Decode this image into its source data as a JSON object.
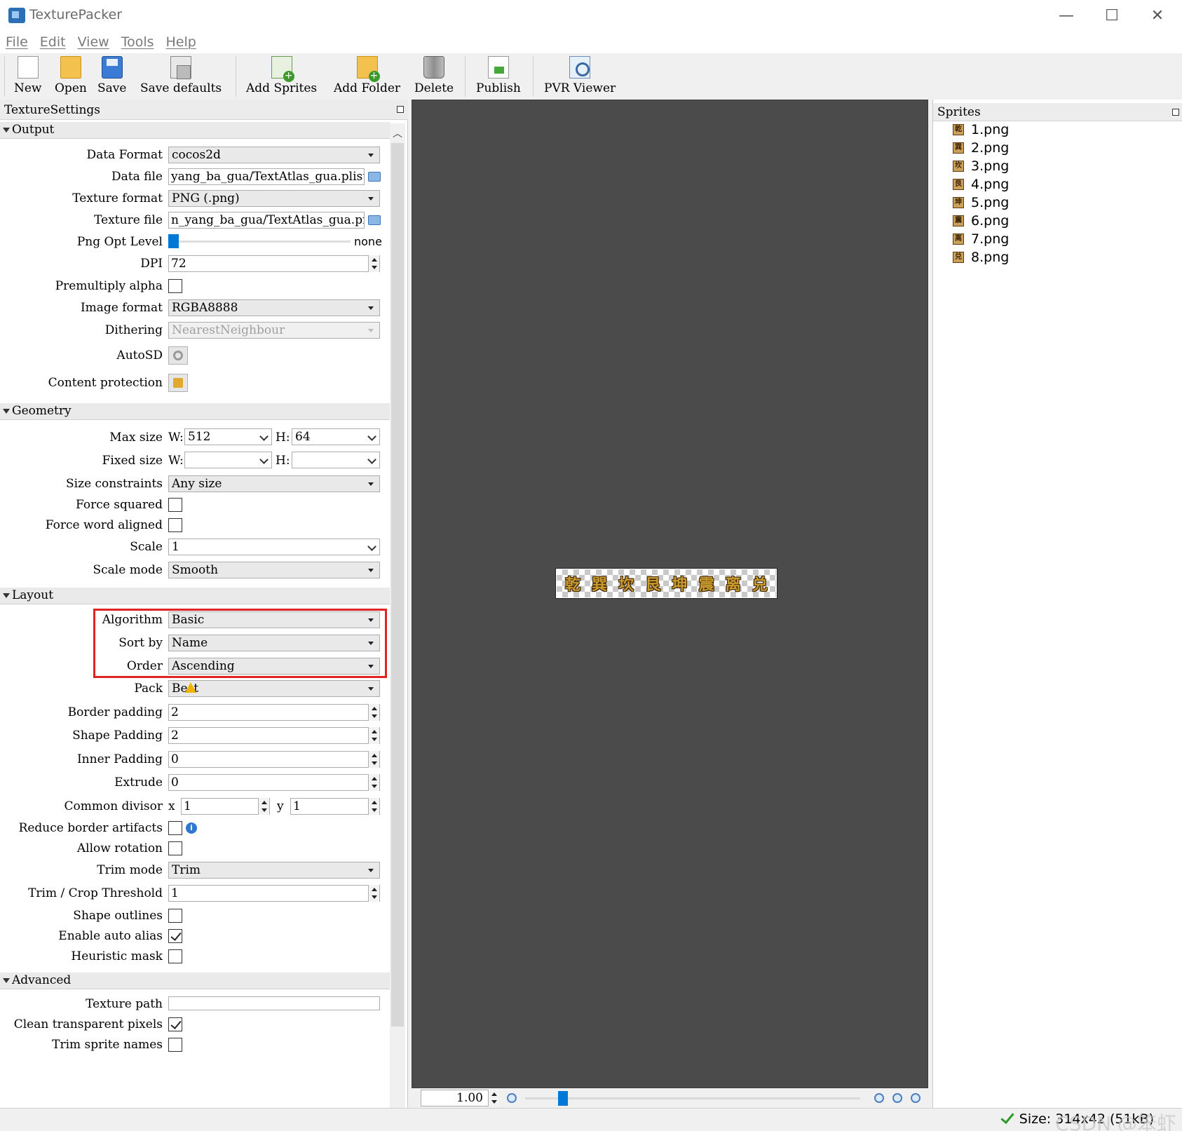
{
  "window": {
    "title": "TexturePacker",
    "minimize": "—",
    "maximize": "☐",
    "close": "✕"
  },
  "menu": [
    "File",
    "Edit",
    "View",
    "Tools",
    "Help"
  ],
  "toolbar": {
    "new": "New",
    "open": "Open",
    "save": "Save",
    "save_defaults": "Save defaults",
    "add_sprites": "Add Sprites",
    "add_folder": "Add Folder",
    "delete": "Delete",
    "publish": "Publish",
    "pvr_viewer": "PVR Viewer"
  },
  "settings": {
    "panel_title": "TextureSettings",
    "output": {
      "section": "Output",
      "data_format_label": "Data Format",
      "data_format": "cocos2d",
      "data_file_label": "Data file",
      "data_file": "yang_ba_gua/TextAtlas_gua.plist",
      "texture_format_label": "Texture format",
      "texture_format": "PNG (.png)",
      "texture_file_label": "Texture file",
      "texture_file": "n_yang_ba_gua/TextAtlas_gua.png",
      "png_opt_label": "Png Opt Level",
      "png_opt_value": "none",
      "png_opt_level": 0,
      "dpi_label": "DPI",
      "dpi": "72",
      "premultiply_label": "Premultiply alpha",
      "premultiply": false,
      "image_format_label": "Image format",
      "image_format": "RGBA8888",
      "dithering_label": "Dithering",
      "dithering": "NearestNeighbour",
      "autosd_label": "AutoSD",
      "content_protection_label": "Content protection"
    },
    "geometry": {
      "section": "Geometry",
      "max_size_label": "Max size",
      "w_label": "W:",
      "h_label": "H:",
      "max_w": "512",
      "max_h": "64",
      "fixed_size_label": "Fixed size",
      "fixed_w": "",
      "fixed_h": "",
      "size_constraints_label": "Size constraints",
      "size_constraints": "Any size",
      "force_squared_label": "Force squared",
      "force_squared": false,
      "force_word_label": "Force word aligned",
      "force_word": false,
      "scale_label": "Scale",
      "scale": "1",
      "scale_mode_label": "Scale mode",
      "scale_mode": "Smooth"
    },
    "layout": {
      "section": "Layout",
      "algorithm_label": "Algorithm",
      "algorithm": "Basic",
      "sort_by_label": "Sort by",
      "sort_by": "Name",
      "order_label": "Order",
      "order": "Ascending",
      "pack_label": "Pack",
      "pack": "Best",
      "border_padding_label": "Border padding",
      "border_padding": "2",
      "shape_padding_label": "Shape Padding",
      "shape_padding": "2",
      "inner_padding_label": "Inner Padding",
      "inner_padding": "0",
      "extrude_label": "Extrude",
      "extrude": "0",
      "common_divisor_label": "Common divisor",
      "x_label": "x",
      "y_label": "y",
      "divisor_x": "1",
      "divisor_y": "1",
      "reduce_border_label": "Reduce border artifacts",
      "reduce_border": false,
      "allow_rotation_label": "Allow rotation",
      "allow_rotation": false,
      "trim_mode_label": "Trim mode",
      "trim_mode": "Trim",
      "trim_threshold_label": "Trim / Crop Threshold",
      "trim_threshold": "1",
      "shape_outlines_label": "Shape outlines",
      "shape_outlines": false,
      "auto_alias_label": "Enable auto alias",
      "auto_alias": true,
      "heuristic_mask_label": "Heuristic mask",
      "heuristic_mask": false
    },
    "advanced": {
      "section": "Advanced",
      "texture_path_label": "Texture path",
      "texture_path": "",
      "clean_transparent_label": "Clean transparent pixels",
      "clean_transparent": true,
      "trim_names_label": "Trim sprite names",
      "trim_names": false
    }
  },
  "preview": {
    "glyphs": [
      "乾",
      "巽",
      "坎",
      "艮",
      "坤",
      "震",
      "离",
      "兑"
    ],
    "zoom": "1.00"
  },
  "sprites": {
    "title": "Sprites",
    "items": [
      {
        "name": "1.png",
        "glyph": "乾"
      },
      {
        "name": "2.png",
        "glyph": "巽"
      },
      {
        "name": "3.png",
        "glyph": "坎"
      },
      {
        "name": "4.png",
        "glyph": "艮"
      },
      {
        "name": "5.png",
        "glyph": "坤"
      },
      {
        "name": "6.png",
        "glyph": "震"
      },
      {
        "name": "7.png",
        "glyph": "离"
      },
      {
        "name": "8.png",
        "glyph": "兑"
      }
    ]
  },
  "status": {
    "size": "Size: 314x42 (51kB)",
    "watermark": "CSDN @笨虾"
  },
  "colors": {
    "highlight_box": "#e02424",
    "canvas": "#4b4b4b",
    "accent": "#0078d7"
  }
}
